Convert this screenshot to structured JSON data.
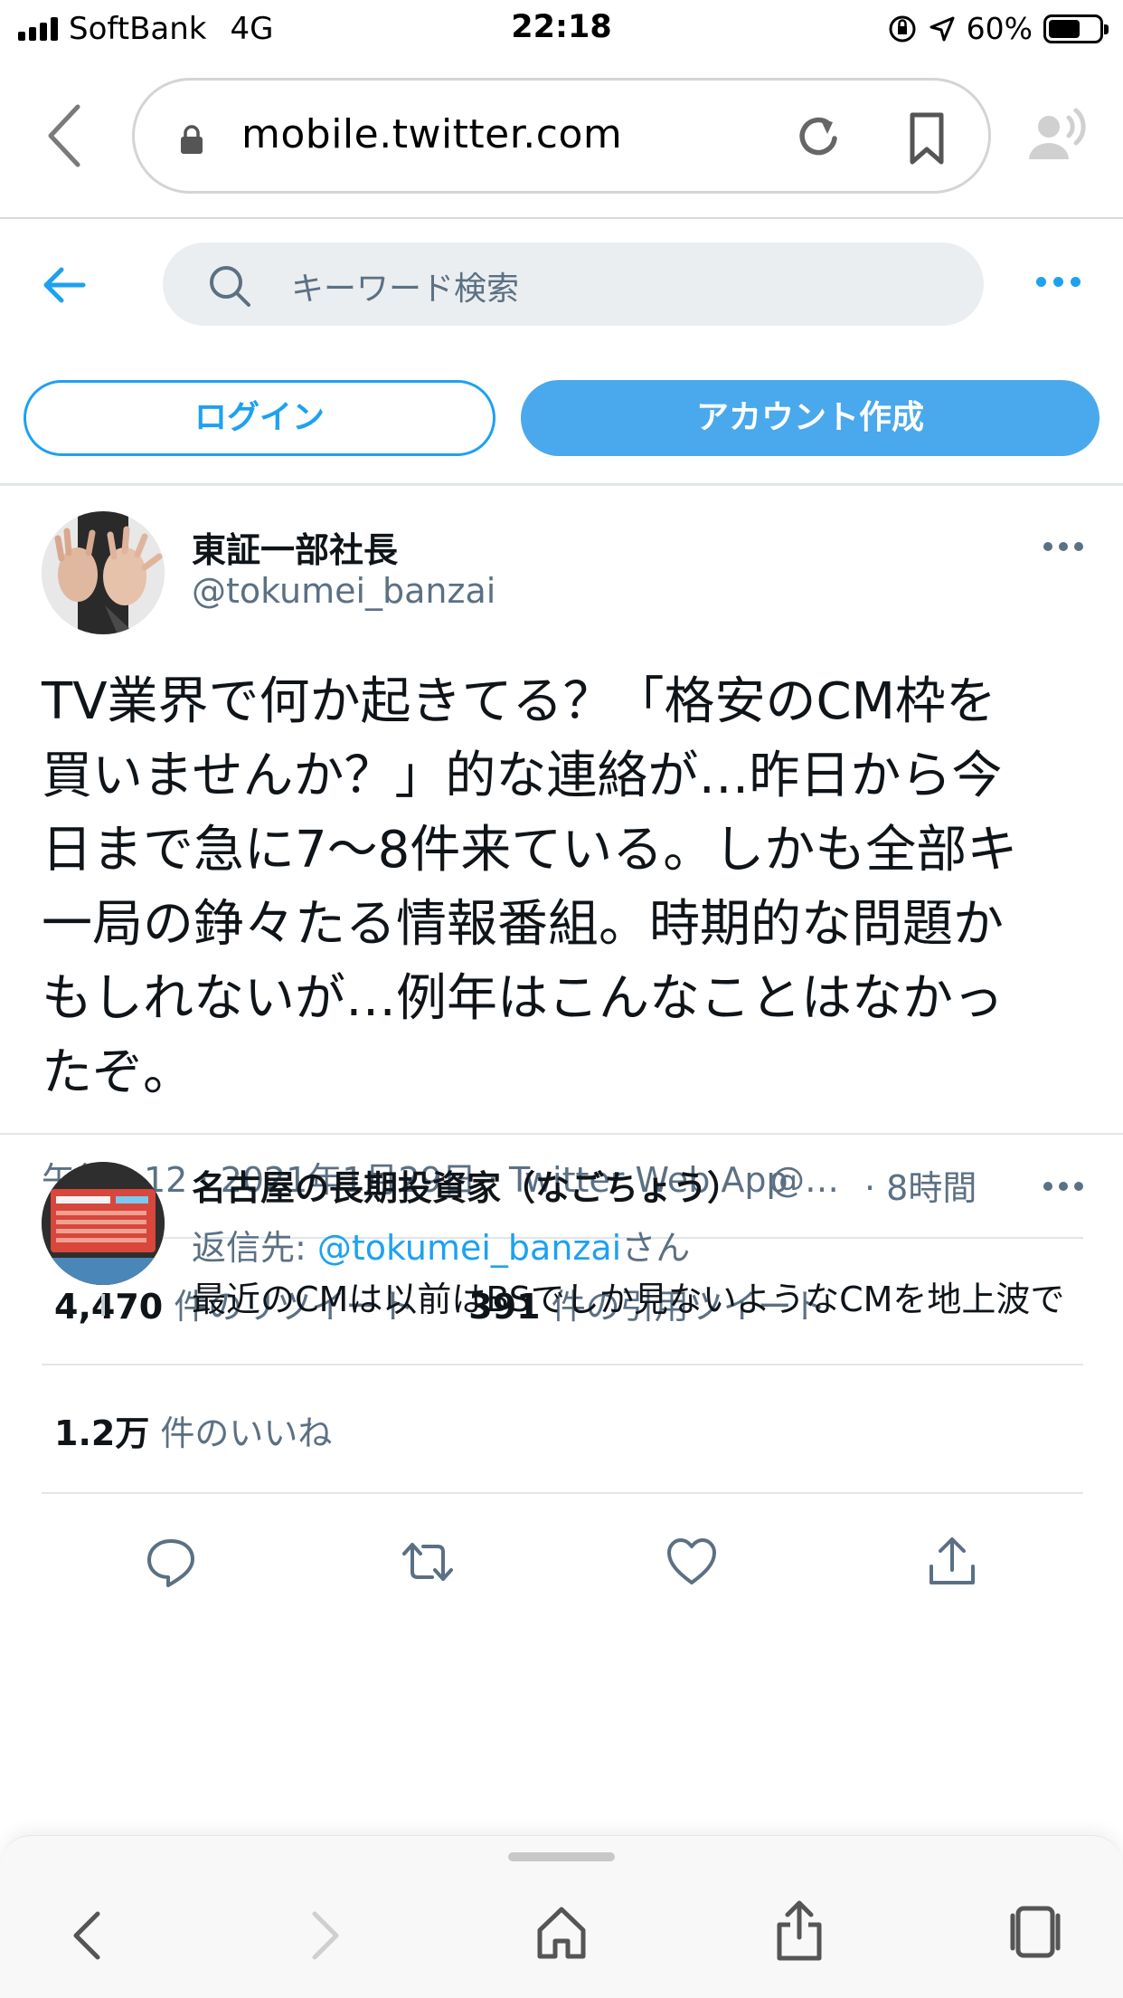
{
  "status_bar": {
    "carrier": "SoftBank",
    "network": "4G",
    "time": "22:18",
    "battery": "60%"
  },
  "browser": {
    "url": "mobile.twitter.com"
  },
  "twitter_header": {
    "search_placeholder": "キーワード検索"
  },
  "auth": {
    "login_label": "ログイン",
    "signup_label": "アカウント作成"
  },
  "tweet": {
    "author_name": "東証一部社長",
    "author_handle": "@tokumei_banzai",
    "text": "TV業界で何か起きてる？「格安のCM枠を\n買いませんか？」的な連絡が…昨日から今\n日まで急に7〜8件来ている。しかも全部キ\n一局の錚々たる情報番組。時期的な問題か\nもしれないが…例年はこんなことはなかっ\nたぞ。",
    "meta": "午後1:12 · 2021年1月29日 · Twitter Web App",
    "retweets_count": "4,470",
    "retweets_label": " 件のリツイート",
    "quotes_count": "391",
    "quotes_label": " 件の引用ツイート",
    "likes_count": "1.2万",
    "likes_label": " 件のいいね"
  },
  "reply": {
    "author_name": "名古屋の長期投資家（なごちょう）",
    "author_handle": "@…",
    "time": "· 8時間",
    "reply_to_prefix": "返信先: ",
    "reply_to_mention": "@tokumei_banzai",
    "reply_to_suffix": "さん",
    "text": "最近のCMは以前はBSでしか見ないようなCMを地上波で見る事が増えたし、それでも枠が埋まらないのか、番"
  },
  "colors": {
    "twitter_blue": "#1da1f2",
    "signup_fill": "#4aa8ec",
    "secondary_text": "#5b7083"
  },
  "icons": [
    "back-chevron-icon",
    "lock-icon",
    "reload-icon",
    "bookmark-icon",
    "reader-audio-icon",
    "back-arrow-icon",
    "search-icon",
    "more-dots-icon",
    "reply-icon",
    "retweet-icon",
    "like-icon",
    "share-icon",
    "home-icon",
    "tabs-icon",
    "forward-chevron-icon"
  ]
}
